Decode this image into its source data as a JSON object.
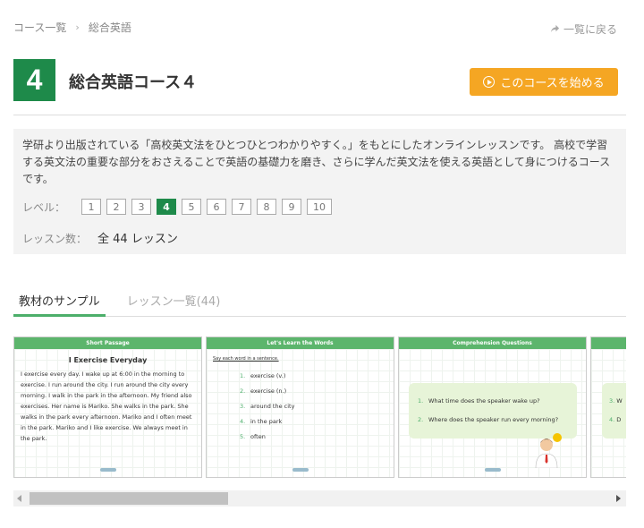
{
  "breadcrumb": {
    "items": [
      "コース一覧",
      "総合英語"
    ],
    "separator": "›"
  },
  "back_link": {
    "label": "一覧に戻る"
  },
  "course": {
    "level_number": "4",
    "title": "総合英語コース４",
    "start_button": "このコースを始める",
    "description": "学研より出版されている「高校英文法をひとつひとつわかりやすく。」をもとにしたオンラインレッスンです。 高校で学習する英文法の重要な部分をおさえることで英語の基礎力を磨き、さらに学んだ英文法を使える英語として身につけるコースです。",
    "level_label": "レベル：",
    "levels": [
      "1",
      "2",
      "3",
      "4",
      "5",
      "6",
      "7",
      "8",
      "9",
      "10"
    ],
    "active_level": "4",
    "lesson_count_label": "レッスン数：",
    "lesson_count_value": "全 44 レッスン"
  },
  "tabs": [
    {
      "label": "教材のサンプル",
      "active": true
    },
    {
      "label": "レッスン一覧(44)",
      "active": false
    }
  ],
  "slides": {
    "s1": {
      "header": "Short Passage",
      "title": "I Exercise Everyday",
      "text": "I exercise every day. I wake up at 6:00 in the morning to exercise. I run around the city. I run around the city every morning. I walk in the park in the afternoon. My friend also exercises. Her name is Mariko. She walks in the park. She walks in the park every afternoon. Mariko and I often meet in the park. Mariko and I like exercise. We always meet in the park."
    },
    "s2": {
      "header": "Let's Learn the Words",
      "instruction": "Say each word in a sentence.",
      "words": [
        {
          "num": "1.",
          "word": "exercise (v.)"
        },
        {
          "num": "2.",
          "word": "exercise (n.)"
        },
        {
          "num": "3.",
          "word": "around the city"
        },
        {
          "num": "4.",
          "word": "in the park"
        },
        {
          "num": "5.",
          "word": "often"
        }
      ]
    },
    "s3": {
      "header": "Comprehension Questions",
      "questions": [
        {
          "num": "1.",
          "text": "What  time does the speaker wake up?"
        },
        {
          "num": "2.",
          "text": "Where does the speaker run every morning?"
        }
      ]
    },
    "s4": {
      "items": [
        {
          "num": "3.",
          "text": "W"
        },
        {
          "num": "4.",
          "text": "D"
        }
      ]
    }
  },
  "colors": {
    "brand_green": "#1e8a4a",
    "accent_orange": "#f5a623",
    "slide_green": "#5cb56c"
  },
  "icons": {
    "back": "share-arrow-icon",
    "play": "play-circle-icon"
  }
}
